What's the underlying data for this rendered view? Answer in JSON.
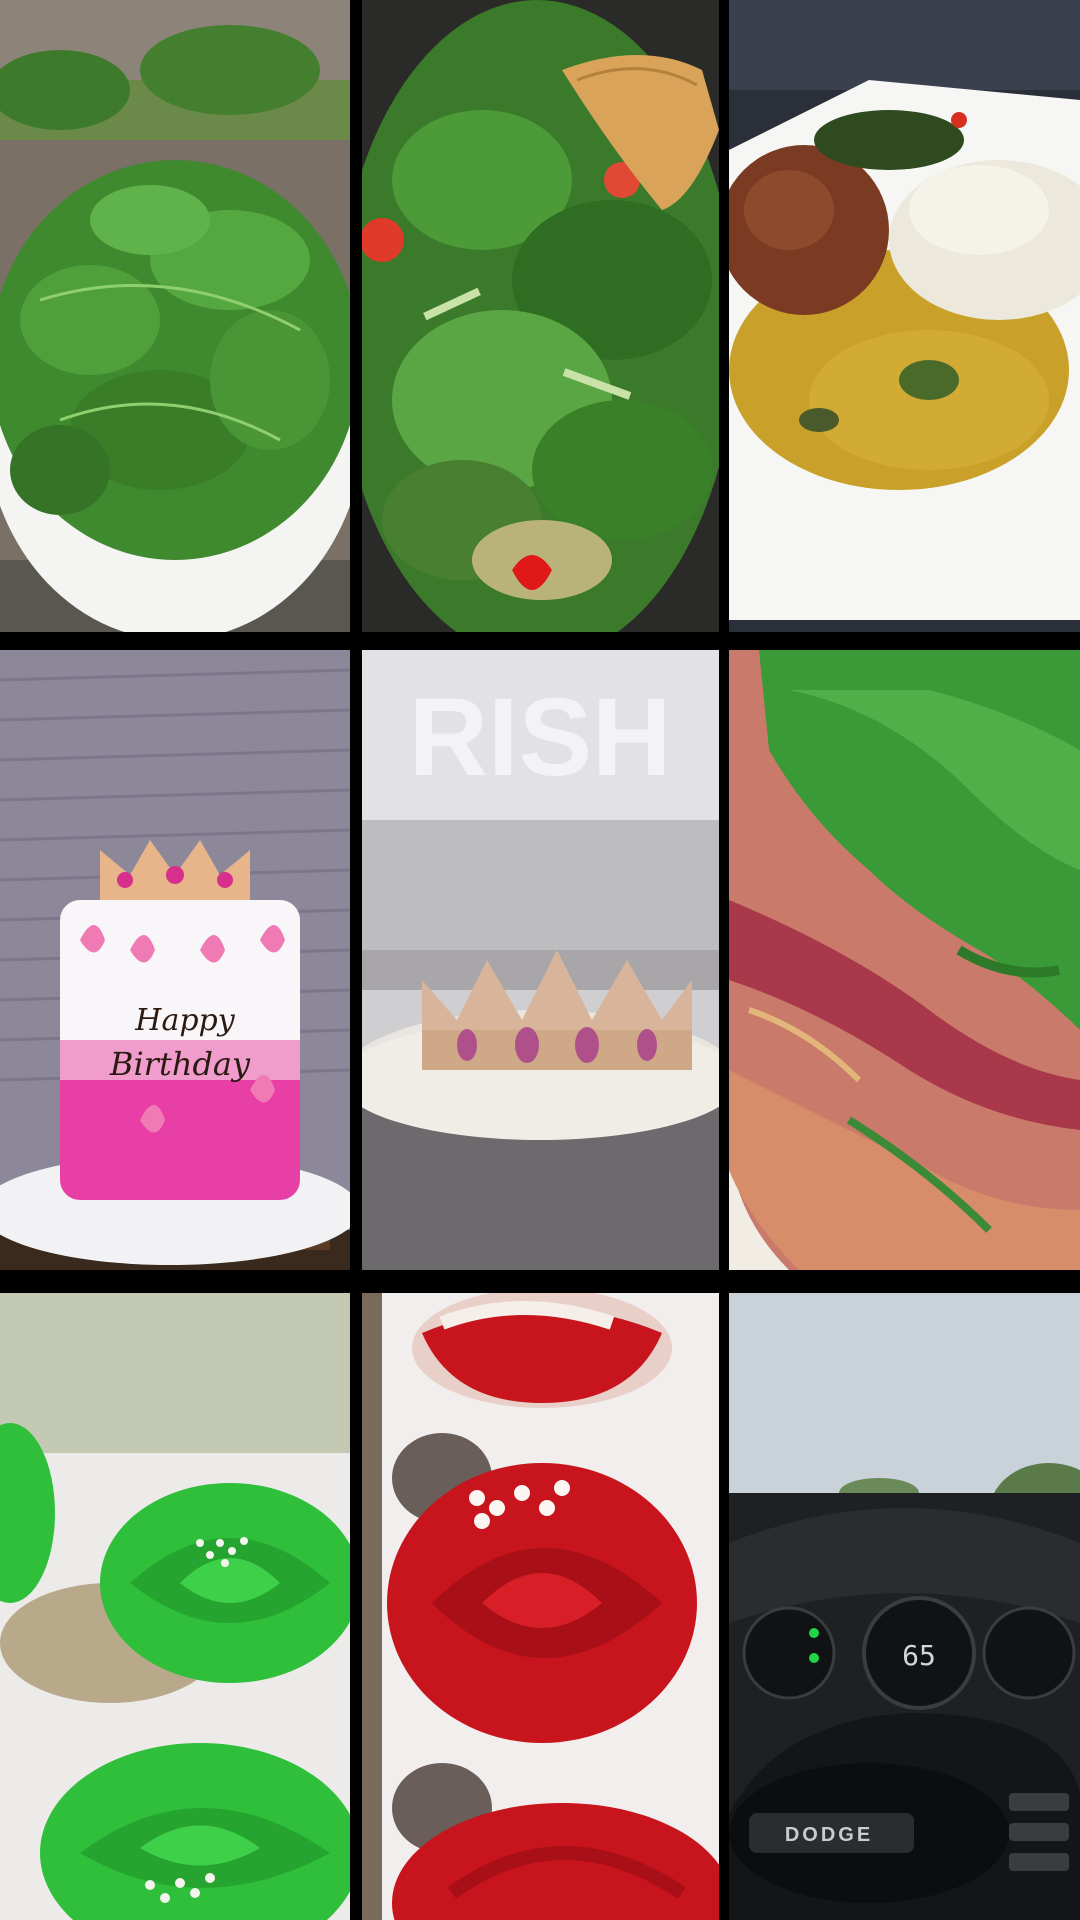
{
  "grid": {
    "tiles": [
      {
        "id": "spinach-bowl",
        "subject": "fresh spinach leaves in a white bowl"
      },
      {
        "id": "sauteed-greens",
        "subject": "sauteed greens with tomato and wooden spoon"
      },
      {
        "id": "rice-plate",
        "subject": "plate with rice, dal and stew"
      },
      {
        "id": "birthday-cake",
        "subject": "pink butterfly birthday cake with crown topper",
        "cake_text": "Happy Birthday"
      },
      {
        "id": "crown-topper",
        "subject": "jeweled crown on cake stand",
        "backdrop_text": "RISH"
      },
      {
        "id": "marbled-flatbread",
        "subject": "green and pink marbled flatbread"
      },
      {
        "id": "green-cupcakes",
        "subject": "green rosette cupcakes with pearls"
      },
      {
        "id": "red-cupcakes",
        "subject": "red velvet rosette cupcakes"
      },
      {
        "id": "car-dashboard",
        "subject": "car dashboard and steering wheel",
        "speed": "65",
        "badge": "DODGE"
      }
    ]
  },
  "colors": {
    "separator": "#000000",
    "spinach": "#3f8a2e",
    "cake_pink": "#e83fa6",
    "frosting_green": "#2fbf3a",
    "frosting_red": "#c8141c"
  }
}
